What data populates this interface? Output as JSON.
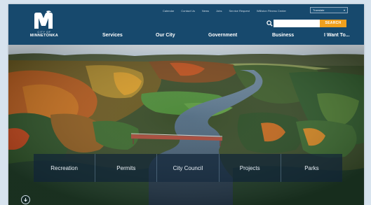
{
  "site": {
    "logo_city": "CITY OF",
    "logo_name": "MINNETONKA"
  },
  "utility_nav": [
    "Calendar",
    "Contact Us",
    "News",
    "Jobs",
    "Service Request",
    "Williston Fitness Center"
  ],
  "translate": {
    "label": "Translate",
    "arrow": "▾"
  },
  "search": {
    "placeholder": "",
    "button_label": "SEARCH"
  },
  "main_nav": [
    "Services",
    "Our City",
    "Government",
    "Business",
    "I Want To..."
  ],
  "quick_links": [
    "Recreation",
    "Permits",
    "City Council",
    "Projects",
    "Parks"
  ],
  "colors": {
    "header_bg": "#17496d",
    "search_button": "#f0a01e",
    "quicklink_bar": "rgba(16,36,56,0.72)"
  },
  "icons": {
    "search": "search-icon",
    "scroll": "scroll-down-icon",
    "logo": "logo-m-icon"
  }
}
